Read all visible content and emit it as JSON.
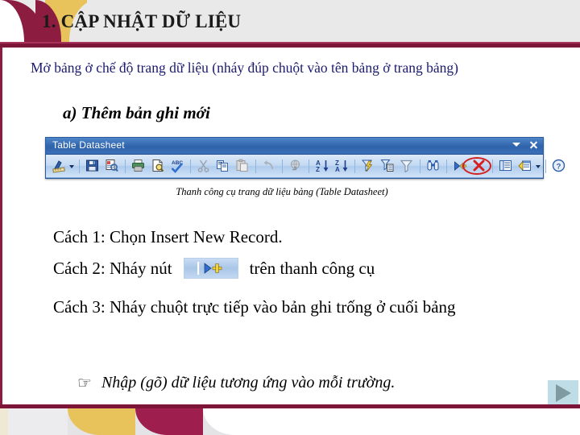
{
  "slide": {
    "title": "1. CẬP NHẬT DỮ LIỆU",
    "intro": "Mở bảng ở chế độ trang dữ liệu (nháy đúp chuột vào tên bảng ở trang bảng)",
    "heading_a": "a) Thêm bản ghi mới",
    "caption": "Thanh công cụ trang dữ liệu bảng (Table Datasheet)",
    "line_1": "Cách 1: Chọn Insert  New Record.",
    "line_2_prefix": "Cách 2: Nháy nút",
    "line_2_suffix": "trên thanh công cụ",
    "line_3": "Cách 3: Nháy chuột trực tiếp vào bản ghi trống ở cuối bảng",
    "note_bullet": "☞",
    "note_text": "Nhập (gõ) dữ liệu tương ứng vào mỗi trường."
  },
  "toolbar": {
    "title": "Table Datasheet",
    "options_icon": "chevron-down-icon",
    "close_icon": "close-icon",
    "buttons": [
      {
        "name": "view-button",
        "label": "View"
      },
      {
        "name": "view-dropdown",
        "label": "View options"
      },
      {
        "name": "save-button",
        "label": "Save"
      },
      {
        "name": "print-preview-button",
        "label": "Print Preview"
      },
      {
        "name": "print-button",
        "label": "Print"
      },
      {
        "name": "print-layout-button",
        "label": "Print Preview"
      },
      {
        "name": "spelling-button",
        "label": "Spelling"
      },
      {
        "name": "cut-button",
        "label": "Cut"
      },
      {
        "name": "copy-button",
        "label": "Copy"
      },
      {
        "name": "paste-button",
        "label": "Paste"
      },
      {
        "name": "undo-button",
        "label": "Undo"
      },
      {
        "name": "insert-hyperlink-button",
        "label": "Insert Hyperlink"
      },
      {
        "name": "sort-ascending-button",
        "label": "Sort Ascending"
      },
      {
        "name": "sort-descending-button",
        "label": "Sort Descending"
      },
      {
        "name": "filter-by-selection-button",
        "label": "Filter By Selection"
      },
      {
        "name": "filter-by-form-button",
        "label": "Filter By Form"
      },
      {
        "name": "remove-filter-button",
        "label": "Apply/Remove Filter"
      },
      {
        "name": "find-button",
        "label": "Find"
      },
      {
        "name": "new-record-button",
        "label": "New Record"
      },
      {
        "name": "delete-record-button",
        "label": "Delete Record"
      },
      {
        "name": "new-object-button",
        "label": "New Object"
      },
      {
        "name": "database-window-button",
        "label": "Database Window"
      },
      {
        "name": "help-button",
        "label": "Microsoft Access Help"
      }
    ],
    "highlight_target": "new-record-button",
    "highlight_color": "#d31f1f"
  },
  "colors": {
    "accent_maroon": "#8c1d40",
    "accent_gold": "#e8c25a",
    "header_bg": "#e9e9ea",
    "intro_text": "#1b1b6f",
    "titlebar_blue": "#2f63ab"
  },
  "next_button": {
    "icon": "play-triangle-icon",
    "label": "Next slide"
  }
}
